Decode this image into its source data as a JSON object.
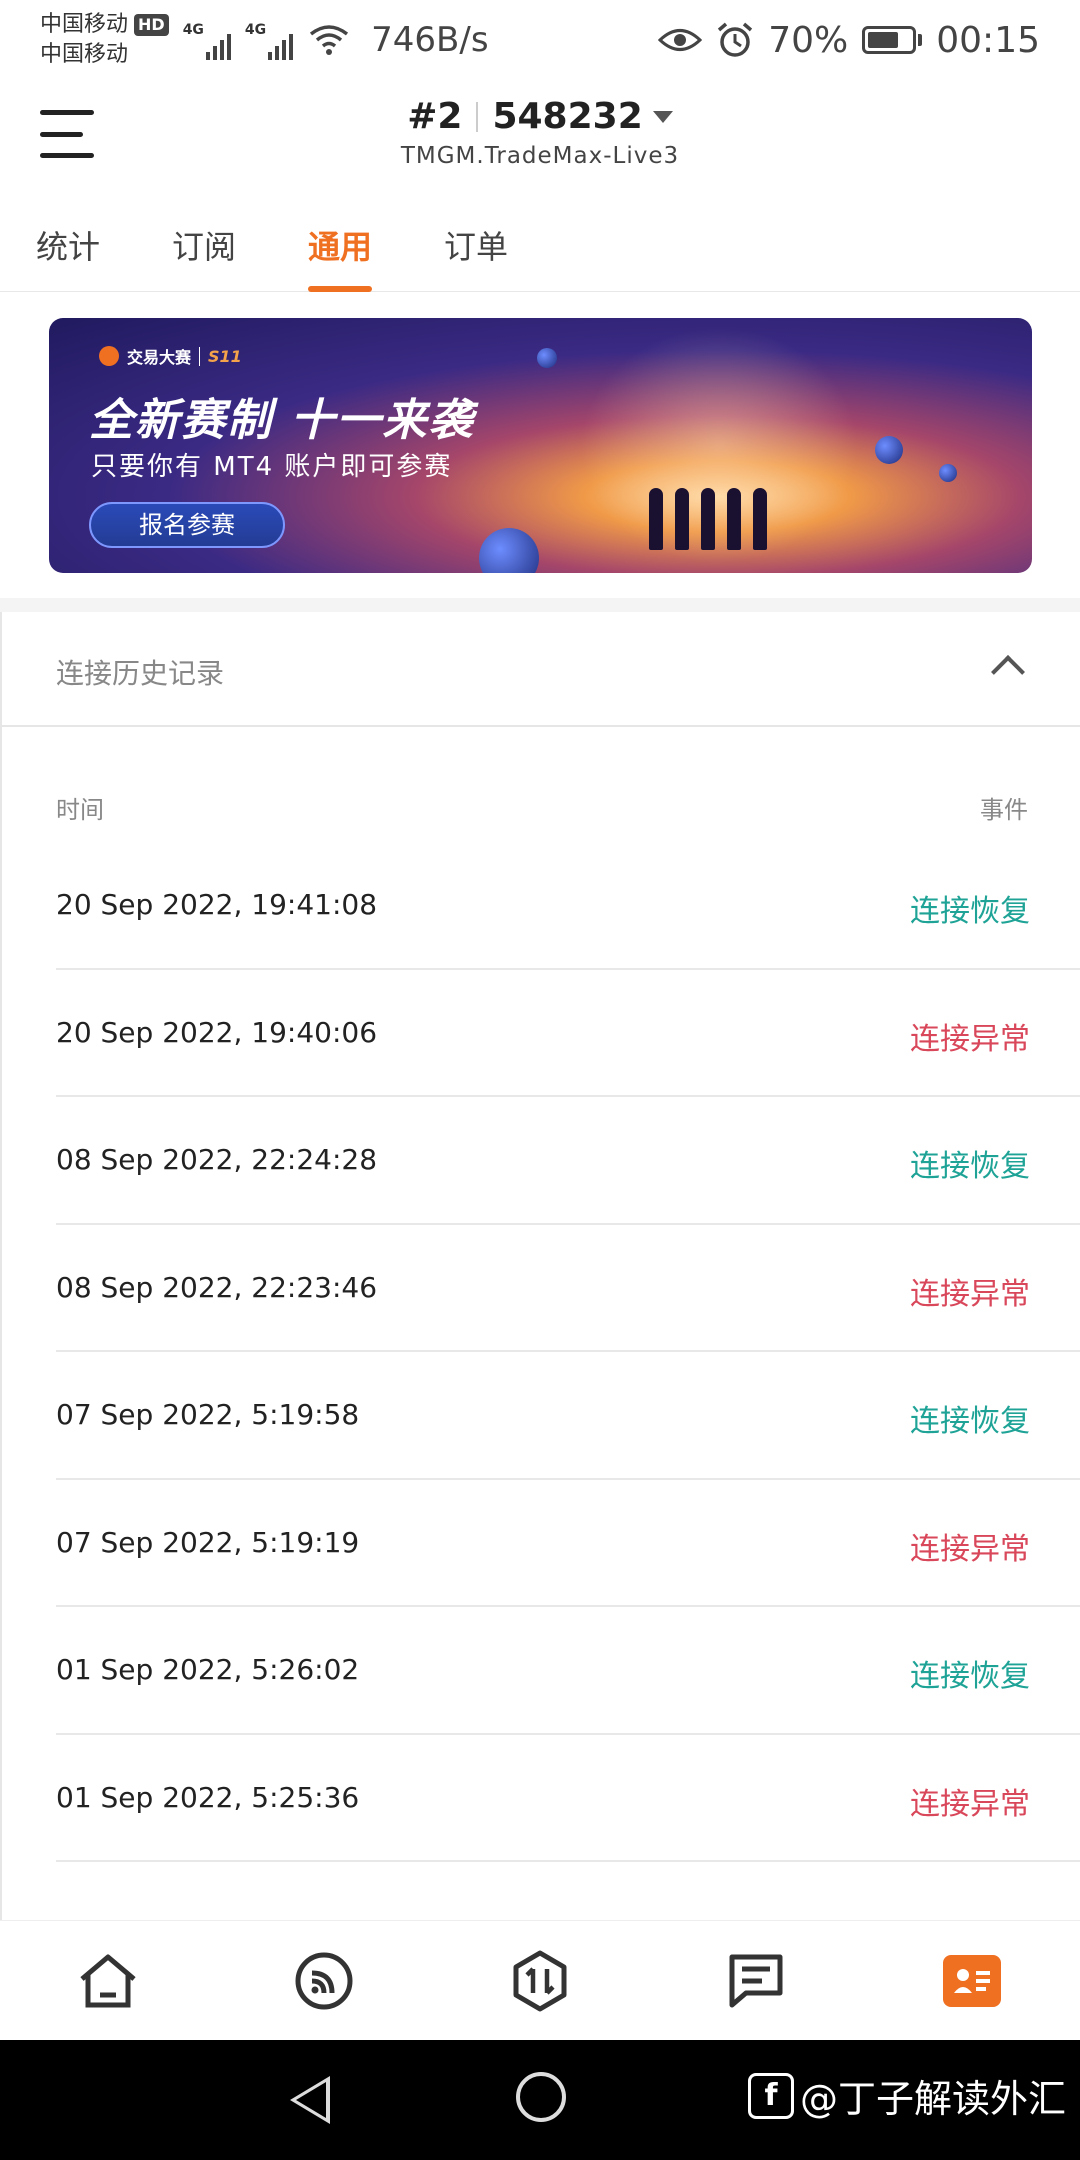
{
  "status_bar": {
    "carrier1": "中国移动",
    "carrier2": "中国移动",
    "hd_badge": "HD",
    "net1": "4G",
    "net2": "4G",
    "speed": "746B/s",
    "battery": "70%",
    "battery_level": 0.7,
    "time": "00:15",
    "icons": [
      "eye-icon",
      "alarm-icon",
      "wifi-icon",
      "signal-icon",
      "battery-icon"
    ]
  },
  "header": {
    "account_index": "#2",
    "account_number": "548232",
    "server": "TMGM.TradeMax-Live3"
  },
  "tabs": [
    {
      "label": "统计"
    },
    {
      "label": "订阅"
    },
    {
      "label": "通用",
      "active": true
    },
    {
      "label": "订单"
    }
  ],
  "banner": {
    "brand": "交易大赛",
    "season": "S11",
    "title": "全新赛制 十一来袭",
    "subtitle": "只要你有 MT4 账户即可参赛",
    "button": "报名参赛"
  },
  "history": {
    "title": "连接历史记录",
    "col_time": "时间",
    "col_event": "事件",
    "rows": [
      {
        "time": "20 Sep 2022, 19:41:08",
        "event": "连接恢复",
        "status": "ok"
      },
      {
        "time": "20 Sep 2022, 19:40:06",
        "event": "连接异常",
        "status": "error"
      },
      {
        "time": "08 Sep 2022, 22:24:28",
        "event": "连接恢复",
        "status": "ok"
      },
      {
        "time": "08 Sep 2022, 22:23:46",
        "event": "连接异常",
        "status": "error"
      },
      {
        "time": "07 Sep 2022, 5:19:58",
        "event": "连接恢复",
        "status": "ok"
      },
      {
        "time": "07 Sep 2022, 5:19:19",
        "event": "连接异常",
        "status": "error"
      },
      {
        "time": "01 Sep 2022, 5:26:02",
        "event": "连接恢复",
        "status": "ok"
      },
      {
        "time": "01 Sep 2022, 5:25:36",
        "event": "连接异常",
        "status": "error"
      }
    ]
  },
  "bottom_nav": [
    "home-icon",
    "subscribe-icon",
    "trade-icon",
    "message-icon",
    "account-icon"
  ],
  "watermark": "@丁子解读外汇",
  "colors": {
    "accent": "#f07022",
    "ok": "#1ea396",
    "error": "#d9475a"
  }
}
